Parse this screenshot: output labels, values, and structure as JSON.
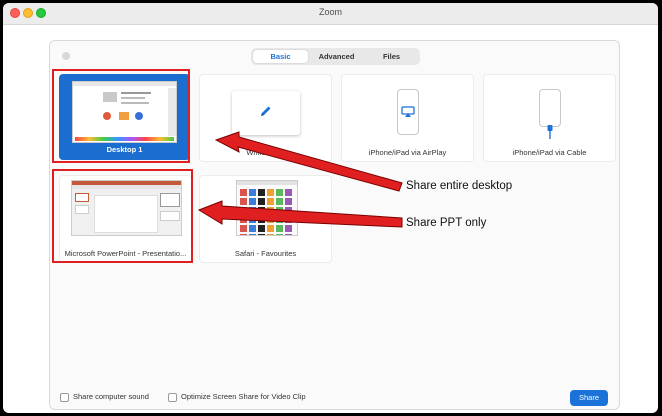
{
  "window": {
    "title": "Zoom"
  },
  "tabs": [
    {
      "label": "Basic",
      "active": true
    },
    {
      "label": "Advanced",
      "active": false
    },
    {
      "label": "Files",
      "active": false
    }
  ],
  "share_items": [
    {
      "label": "Desktop 1",
      "selected": true,
      "icon": "desktop-thumbnail"
    },
    {
      "label": "Whiteboard",
      "selected": false,
      "icon": "pencil-icon"
    },
    {
      "label": "iPhone/iPad via AirPlay",
      "selected": false,
      "icon": "airplay-icon"
    },
    {
      "label": "iPhone/iPad via Cable",
      "selected": false,
      "icon": "cable-icon"
    },
    {
      "label": "Microsoft PowerPoint - Presentatio...",
      "selected": false,
      "icon": "powerpoint-thumbnail"
    },
    {
      "label": "Safari - Favourites",
      "selected": false,
      "icon": "safari-thumbnail"
    }
  ],
  "footer": {
    "share_sound": "Share computer sound",
    "optimize": "Optimize Screen Share for Video Clip",
    "share_button": "Share"
  },
  "annotations": {
    "desktop": "Share entire desktop",
    "ppt": "Share PPT only"
  },
  "colors": {
    "accent": "#1b72d8",
    "annotation": "#e02020"
  }
}
